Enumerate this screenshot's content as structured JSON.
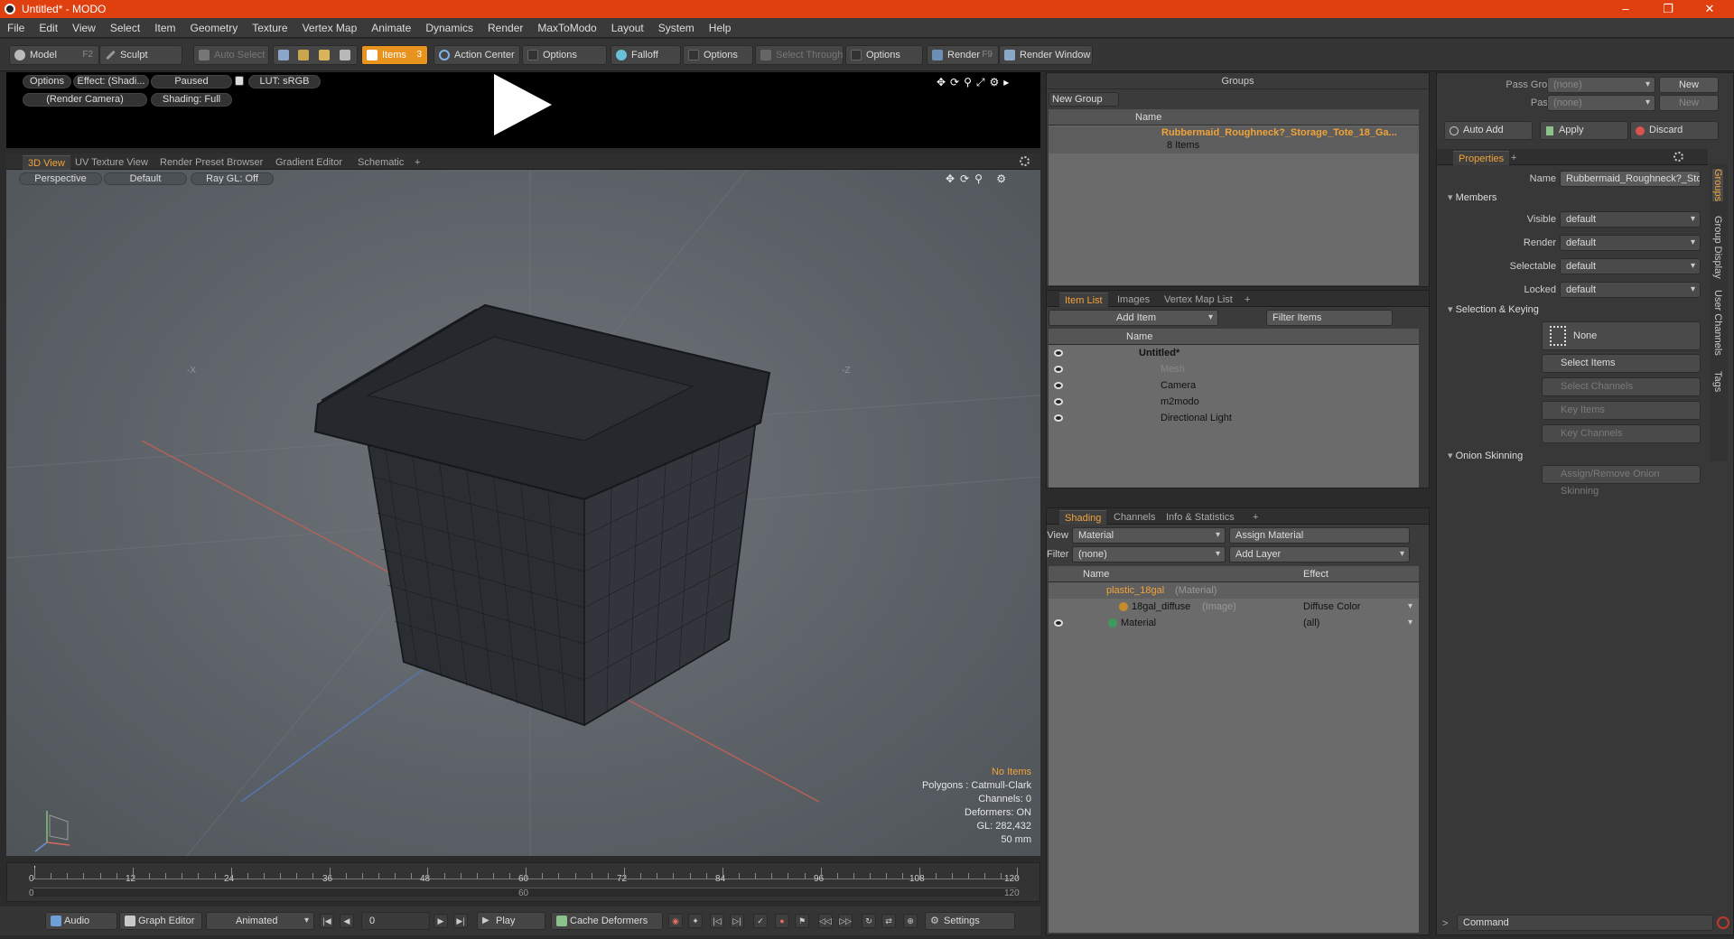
{
  "window": {
    "title": "Untitled* - MODO",
    "minimize": "–",
    "maximize": "❐",
    "close": "✕"
  },
  "menu": [
    "File",
    "Edit",
    "View",
    "Select",
    "Item",
    "Geometry",
    "Texture",
    "Vertex Map",
    "Animate",
    "Dynamics",
    "Render",
    "MaxToModo",
    "Layout",
    "System",
    "Help"
  ],
  "toolbar": {
    "model": "Model",
    "model_key": "F2",
    "sculpt": "Sculpt",
    "auto_select": "Auto Select",
    "items": "Items",
    "items_key": "3",
    "action_center": "Action Center",
    "options1": "Options",
    "falloff": "Falloff",
    "options2": "Options",
    "select_through": "Select Through",
    "options3": "Options",
    "render": "Render",
    "render_key": "F9",
    "render_window": "Render Window"
  },
  "preview": {
    "options": "Options",
    "effect": "Effect: (Shadi...",
    "paused": "Paused",
    "lut": "LUT: sRGB",
    "camera": "(Render Camera)",
    "shading": "Shading: Full"
  },
  "viewport_tabs": [
    "3D View",
    "UV Texture View",
    "Render Preset Browser",
    "Gradient Editor",
    "Schematic",
    "+"
  ],
  "viewport": {
    "perspective": "Perspective",
    "default": "Default",
    "raygl": "Ray GL: Off",
    "axis_x": "-X",
    "axis_z": "-Z",
    "stats": {
      "no_items": "No Items",
      "polygons": "Polygons : Catmull-Clark",
      "channels": "Channels: 0",
      "deformers": "Deformers: ON",
      "gl": "GL: 282,432",
      "lens": "50 mm"
    }
  },
  "timeline": {
    "ticks": [
      "0",
      "12",
      "24",
      "36",
      "48",
      "60",
      "72",
      "84",
      "96",
      "108",
      "120"
    ],
    "lower_ticks": [
      "0",
      "60",
      "120"
    ]
  },
  "bottombar": {
    "audio": "Audio",
    "graph_editor": "Graph Editor",
    "animated": "Animated",
    "frame": "0",
    "play": "Play",
    "cache": "Cache Deformers",
    "settings": "Settings"
  },
  "groups": {
    "title": "Groups",
    "new_group": "New Group",
    "col_name": "Name",
    "item_name": "Rubbermaid_Roughneck?_Storage_Tote_18_Ga...",
    "item_count": "8 Items"
  },
  "item_list": {
    "tabs": [
      "Item List",
      "Images",
      "Vertex Map List",
      "+"
    ],
    "add_item": "Add Item",
    "filter": "Filter Items",
    "col_name": "Name",
    "rows": [
      "Untitled*",
      "Mesh",
      "Camera",
      "m2modo",
      "Directional Light"
    ]
  },
  "shading": {
    "tabs": [
      "Shading",
      "Channels",
      "Info & Statistics",
      "+"
    ],
    "view_label": "View",
    "view_value": "Material",
    "assign": "Assign Material",
    "filter_label": "Filter",
    "filter_value": "(none)",
    "add_layer": "Add Layer",
    "col_name": "Name",
    "col_effect": "Effect",
    "rows": [
      {
        "name": "plastic_18gal",
        "tag": "(Material)",
        "effect": ""
      },
      {
        "name": "18gal_diffuse",
        "tag": "(Image)",
        "effect": "Diffuse Color"
      },
      {
        "name": "Material",
        "tag": "",
        "effect": "(all)"
      }
    ]
  },
  "right": {
    "pass_groups_label": "Pass Groups",
    "pass_groups_value": "(none)",
    "new1": "New",
    "passes_label": "Passes",
    "passes_value": "(none)",
    "new2": "New",
    "auto_add": "Auto Add",
    "apply": "Apply",
    "discard": "Discard",
    "properties_tab": "Properties",
    "plus": "+",
    "name_label": "Name",
    "name_value": "Rubbermaid_Roughneck?_Storage_",
    "members": "Members",
    "visible_label": "Visible",
    "render_label": "Render",
    "selectable_label": "Selectable",
    "locked_label": "Locked",
    "default_value": "default",
    "selection_keying": "Selection & Keying",
    "none": "None",
    "select_items": "Select Items",
    "select_channels": "Select Channels",
    "key_items": "Key Items",
    "key_channels": "Key Channels",
    "onion": "Onion Skinning",
    "assign_onion": "Assign/Remove Onion Skinning",
    "vtabs": [
      "Groups",
      "Group Display",
      "User Channels",
      "Tags"
    ],
    "command": "Command"
  },
  "colors": {
    "accent": "#f0a33a",
    "titlebar": "#e0400f"
  }
}
